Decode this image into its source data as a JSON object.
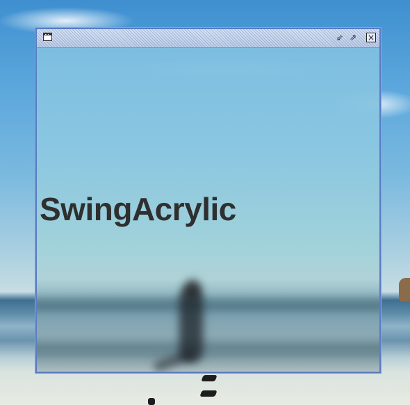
{
  "window": {
    "title": "",
    "content_title": "SwingAcrylic",
    "icons": {
      "app": "window-icon",
      "minimize": "iconify-icon",
      "maximize": "maximize-icon",
      "close": "close-icon"
    },
    "glyphs": {
      "minimize": "⇙",
      "maximize": "⇗",
      "close": "×"
    },
    "colors": {
      "border": "#5b7cc4",
      "title_text": "#2f2f2f"
    }
  }
}
